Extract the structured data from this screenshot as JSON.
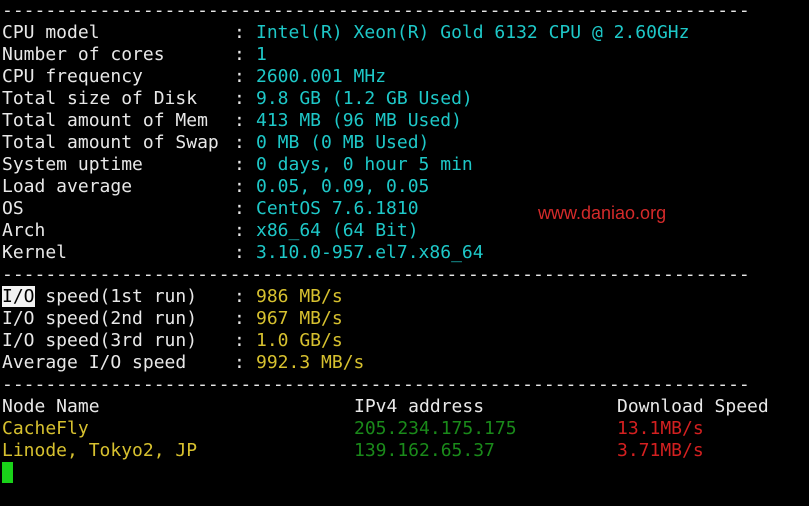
{
  "separator": "---------------------------------------------------------------------",
  "system_info": [
    {
      "label": "CPU model",
      "value": "Intel(R) Xeon(R) Gold 6132 CPU @ 2.60GHz"
    },
    {
      "label": "Number of cores",
      "value": "1"
    },
    {
      "label": "CPU frequency",
      "value": "2600.001 MHz"
    },
    {
      "label": "Total size of Disk",
      "value": "9.8 GB (1.2 GB Used)"
    },
    {
      "label": "Total amount of Mem",
      "value": "413 MB (96 MB Used)"
    },
    {
      "label": "Total amount of Swap",
      "value": "0 MB (0 MB Used)"
    },
    {
      "label": "System uptime",
      "value": "0 days, 0 hour 5 min"
    },
    {
      "label": "Load average",
      "value": "0.05, 0.09, 0.05"
    },
    {
      "label": "OS",
      "value": "CentOS 7.6.1810"
    },
    {
      "label": "Arch",
      "value": "x86_64 (64 Bit)"
    },
    {
      "label": "Kernel",
      "value": "3.10.0-957.el7.x86_64"
    }
  ],
  "io_speed": {
    "first_label_highlight": "I/O",
    "first_label_rest": " speed(1st run)",
    "rows": [
      {
        "label": "I/O speed(1st run)",
        "value": "986 MB/s"
      },
      {
        "label": "I/O speed(2nd run)",
        "value": "967 MB/s"
      },
      {
        "label": "I/O speed(3rd run)",
        "value": "1.0 GB/s"
      },
      {
        "label": "Average I/O speed",
        "value": "992.3 MB/s"
      }
    ]
  },
  "network": {
    "headers": {
      "node": "Node Name",
      "ipv4": "IPv4 address",
      "speed": "Download Speed"
    },
    "rows": [
      {
        "node": "CacheFly",
        "ipv4": "205.234.175.175",
        "speed": "13.1MB/s"
      },
      {
        "node": "Linode, Tokyo2, JP",
        "ipv4": "139.162.65.37",
        "speed": "3.71MB/s"
      }
    ]
  },
  "colon": ":",
  "watermark": "www.daniao.org",
  "colors": {
    "background": "#000000",
    "text": "#e8e8e8",
    "value_cyan": "#1ec8c8",
    "value_yellow": "#d7c12f",
    "ip_green": "#1a8a1a",
    "speed_red": "#d42020",
    "cursor": "#19d219"
  }
}
